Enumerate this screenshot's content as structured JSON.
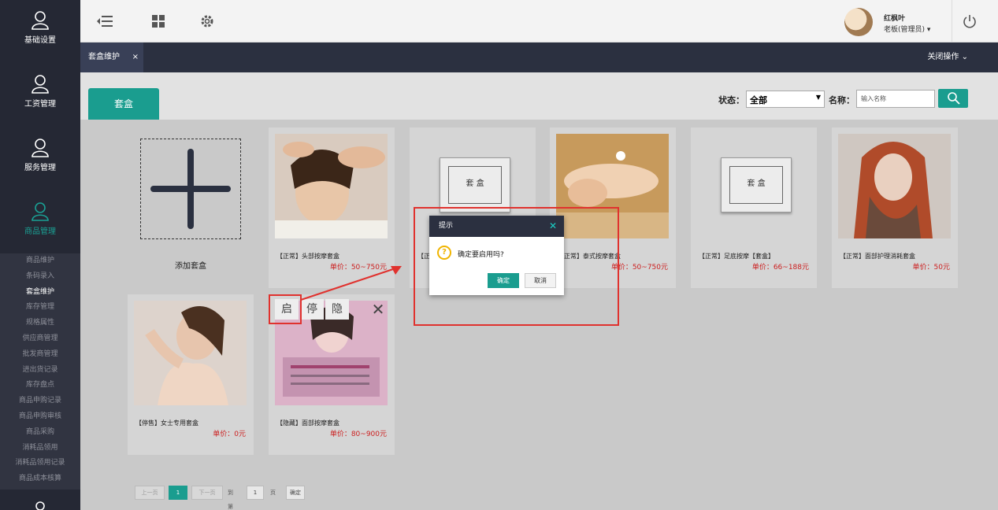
{
  "sidebar": {
    "main": [
      {
        "label": "基础设置",
        "icon": "user-icon"
      },
      {
        "label": "工资管理",
        "icon": "user-icon"
      },
      {
        "label": "服务管理",
        "icon": "user-icon"
      },
      {
        "label": "商品管理",
        "icon": "user-icon",
        "active": true
      }
    ],
    "sub": [
      "商品维护",
      "条码录入",
      "套盒维护",
      "库存管理",
      "规格属性",
      "供应商管理",
      "批发商管理",
      "进出货记录",
      "库存盘点",
      "商品申购记录",
      "商品申购审核",
      "商品采购",
      "消耗品领用",
      "消耗品领用记录",
      "商品成本核算"
    ],
    "active_sub": "套盒维护"
  },
  "topbar": {
    "user_name": "红枫叶",
    "user_role": "老板(管理员) ▾",
    "icons": [
      "collapse-menu-icon",
      "grid-icon",
      "gear-icon",
      "power-icon"
    ]
  },
  "tabbar": {
    "tab_label": "套盒维护",
    "tab_close": "×",
    "close_ops": "关闭操作 ⌄"
  },
  "filter": {
    "tab_badge": "套盒",
    "status_label": "状态：",
    "status_value": "全部",
    "name_label": "名称：",
    "name_placeholder": "输入名称"
  },
  "add_card": {
    "label": "添加套盒"
  },
  "cards": [
    {
      "title": "【正常】头部按摩套盒",
      "price": "单价：50~750元"
    },
    {
      "title": "【正",
      "price": ""
    },
    {
      "title": "【正常】泰式按摩套盒",
      "price": "单价：50~750元"
    },
    {
      "title": "【正常】足底按摩【套盒】",
      "price": "单价：66~188元"
    },
    {
      "title": "【正常】面部护理消耗套盒",
      "price": "单价：50元"
    },
    {
      "title": "【停售】女士专用套盒",
      "price": "单价：0元"
    },
    {
      "title": "【隐藏】面部按摩套盒",
      "price": "单价：80~900元"
    }
  ],
  "pkg_label": "套 盒",
  "card_actions": {
    "enable": "启",
    "stop": "停",
    "hide": "隐",
    "close": "✕"
  },
  "pager": {
    "prev": "上一页",
    "current": "1",
    "next": "下一页",
    "goto": "到第",
    "page_input": "1",
    "page_unit": "页",
    "confirm": "确定"
  },
  "dialog": {
    "title": "提示",
    "close": "✕",
    "message": "确定要启用吗?",
    "icon": "?",
    "ok": "确定",
    "cancel": "取消"
  },
  "colors": {
    "accent": "#1a9d8f",
    "sidebar": "#252834",
    "highlight": "#e0322e",
    "price": "#cc1f1f"
  }
}
